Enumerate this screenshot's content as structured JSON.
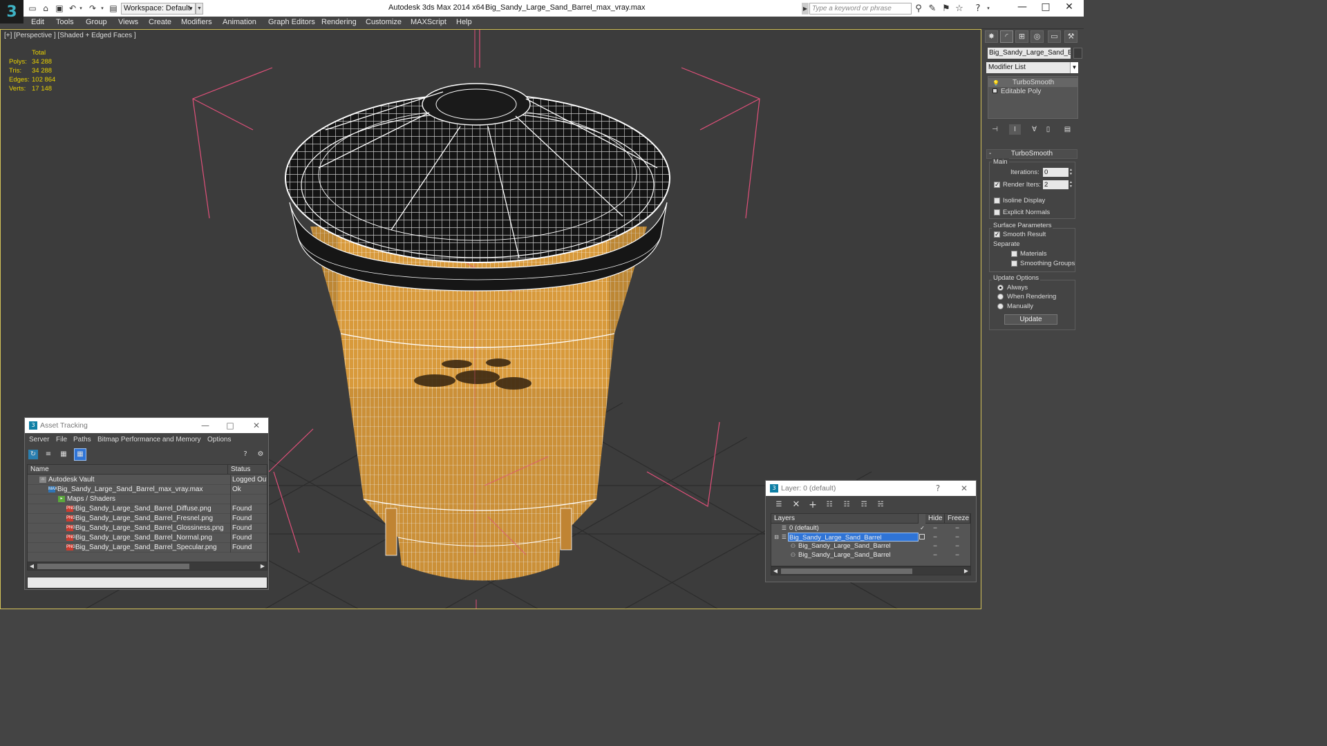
{
  "titlebar": {
    "workspace": "Workspace: Default",
    "app_title": "Autodesk 3ds Max  2014 x64",
    "file_title": "Big_Sandy_Large_Sand_Barrel_max_vray.max",
    "search_placeholder": "Type a keyword or phrase"
  },
  "menu": {
    "items": [
      "Edit",
      "Tools",
      "Group",
      "Views",
      "Create",
      "Modifiers",
      "Animation",
      "Graph Editors",
      "Rendering",
      "Customize",
      "MAXScript",
      "Help"
    ]
  },
  "viewport": {
    "label": "[+] [Perspective ] [Shaded + Edged Faces ]",
    "stats": {
      "header": "Total",
      "rows": [
        {
          "label": "Polys:",
          "value": "34 288"
        },
        {
          "label": "Tris:",
          "value": "34 288"
        },
        {
          "label": "Edges:",
          "value": "102 864"
        },
        {
          "label": "Verts:",
          "value": "17 148"
        }
      ]
    },
    "colors": {
      "barrel": "#d89a3c",
      "lid": "#1a1a1a",
      "wire": "#ffffff",
      "grid": "#2e2e2e",
      "bbox": "#e0507a"
    }
  },
  "command_panel": {
    "object_name": "Big_Sandy_Large_Sand_Barrel",
    "modifier_list": "Modifier List",
    "stack": [
      "TurboSmooth",
      "Editable Poly"
    ],
    "rollout_title": "TurboSmooth",
    "main_group": "Main",
    "iterations_label": "Iterations:",
    "iterations_value": "0",
    "render_iters_label": "Render Iters:",
    "render_iters_value": "2",
    "render_iters_checked": true,
    "isoline_label": "Isoline Display",
    "isoline_checked": false,
    "explicit_normals_label": "Explicit Normals",
    "explicit_normals_checked": false,
    "surface_group": "Surface Parameters",
    "smooth_result_label": "Smooth Result",
    "smooth_result_checked": true,
    "separate_label": "Separate",
    "materials_label": "Materials",
    "materials_checked": false,
    "smoothing_groups_label": "Smoothing Groups",
    "smoothing_groups_checked": false,
    "update_group": "Update Options",
    "update_options": [
      "Always",
      "When Rendering",
      "Manually"
    ],
    "update_selected": "Always",
    "update_button": "Update"
  },
  "asset_tracking": {
    "title": "Asset Tracking",
    "menu": [
      "Server",
      "File",
      "Paths",
      "Bitmap Performance and Memory",
      "Options"
    ],
    "columns": [
      "Name",
      "Status"
    ],
    "rows": [
      {
        "name": "Autodesk Vault",
        "status": "Logged Out",
        "icon": "vault"
      },
      {
        "name": "Big_Sandy_Large_Sand_Barrel_max_vray.max",
        "status": "Ok",
        "icon": "max"
      },
      {
        "name": "Maps / Shaders",
        "status": "",
        "icon": "folder"
      },
      {
        "name": "Big_Sandy_Large_Sand_Barrel_Diffuse.png",
        "status": "Found",
        "icon": "png"
      },
      {
        "name": "Big_Sandy_Large_Sand_Barrel_Fresnel.png",
        "status": "Found",
        "icon": "png"
      },
      {
        "name": "Big_Sandy_Large_Sand_Barrel_Glossiness.png",
        "status": "Found",
        "icon": "png"
      },
      {
        "name": "Big_Sandy_Large_Sand_Barrel_Normal.png",
        "status": "Found",
        "icon": "png"
      },
      {
        "name": "Big_Sandy_Large_Sand_Barrel_Specular.png",
        "status": "Found",
        "icon": "png"
      }
    ]
  },
  "layer_dialog": {
    "title": "Layer: 0 (default)",
    "columns": [
      "Layers",
      "Hide",
      "Freeze"
    ],
    "rows": [
      {
        "name": "0 (default)",
        "selected": false
      },
      {
        "name": "Big_Sandy_Large_Sand_Barrel",
        "selected": true
      },
      {
        "name": "Big_Sandy_Large_Sand_Barrel",
        "selected": false
      },
      {
        "name": "Big_Sandy_Large_Sand_Barrel",
        "selected": false
      }
    ]
  }
}
